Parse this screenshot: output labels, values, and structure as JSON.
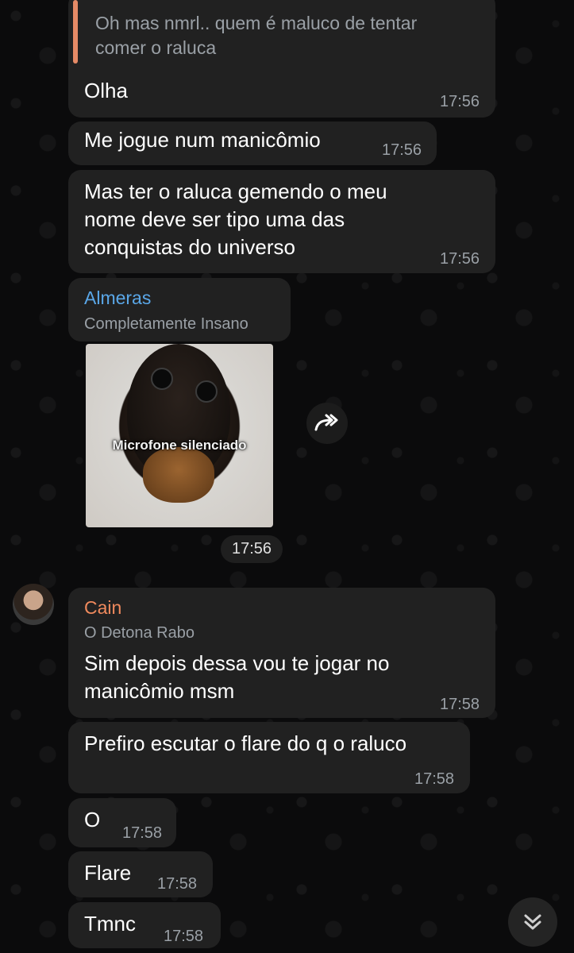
{
  "messages": [
    {
      "quote": "Oh mas nmrl.. quem é maluco de tentar\ncomer o raluca",
      "text": "Olha",
      "time": "17:56"
    },
    {
      "text": "Me jogue num manicômio",
      "time": "17:56"
    },
    {
      "text": "Mas ter o raluca gemendo o meu\nnome deve ser tipo uma das\nconquistas do universo",
      "time": "17:56"
    },
    {
      "sender": "Almeras",
      "subtitle": "Completamente Insano",
      "sticker_label": "Microfone silenciado",
      "time": "17:56",
      "sender_color": "#5aa7e8"
    },
    {
      "sender": "Cain",
      "subtitle": "O Detona Rabo",
      "text": "Sim depois dessa vou te jogar no\nmanicômio msm",
      "time": "17:58",
      "sender_color": "#f08a5d"
    },
    {
      "text": "Prefiro escutar o flare do q o raluco",
      "time": "17:58"
    },
    {
      "text": "O",
      "time": "17:58"
    },
    {
      "text": "Flare",
      "time": "17:58"
    },
    {
      "text": "Tmnc",
      "time": "17:58"
    }
  ],
  "icons": {
    "share": "share-forward-icon",
    "scroll": "double-chevron-down-icon"
  }
}
